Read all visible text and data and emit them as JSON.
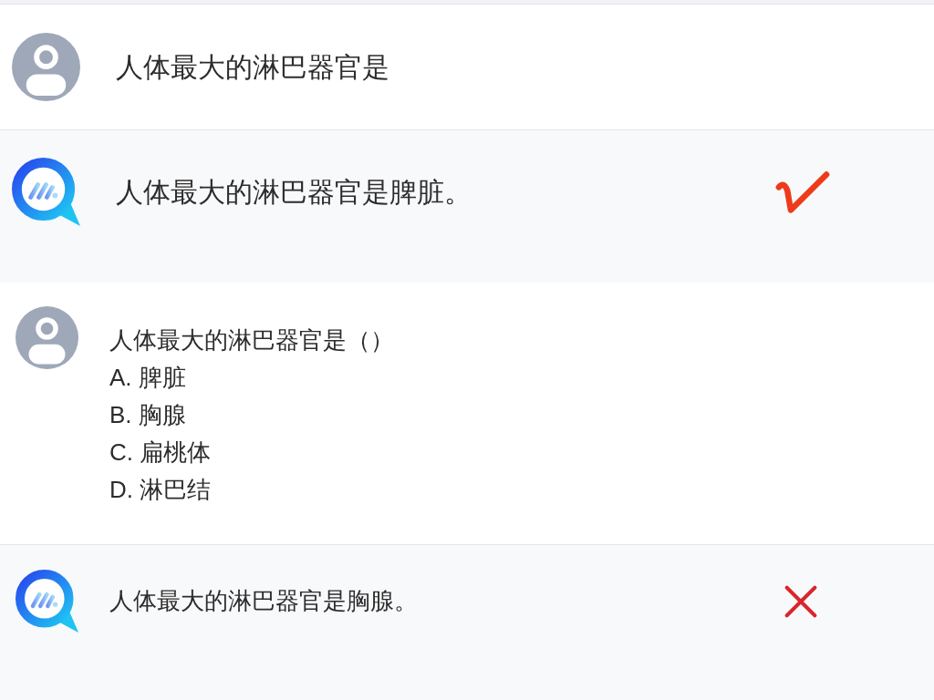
{
  "panels": [
    {
      "messages": [
        {
          "kind": "user",
          "text": "人体最大的淋巴器官是"
        },
        {
          "kind": "assistant",
          "text": "人体最大的淋巴器官是脾脏。",
          "correct": true
        }
      ]
    },
    {
      "messages": [
        {
          "kind": "user",
          "text": "人体最大的淋巴器官是（）",
          "options": [
            "A. 脾脏",
            "B. 胸腺",
            "C. 扁桃体",
            "D. 淋巴结"
          ]
        },
        {
          "kind": "assistant",
          "text": "人体最大的淋巴器官是胸腺。",
          "correct": false
        }
      ]
    }
  ]
}
